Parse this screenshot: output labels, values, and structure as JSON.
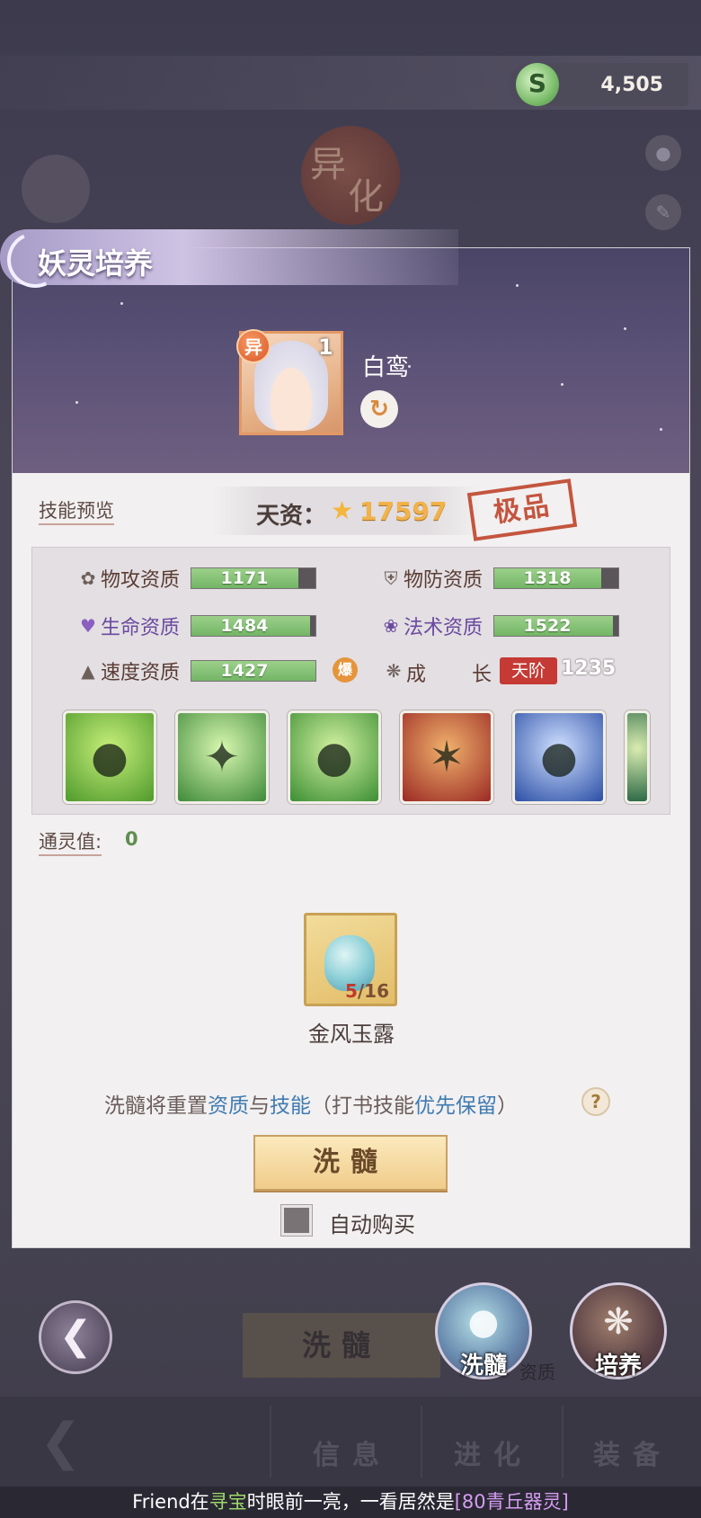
{
  "header": {
    "currency_icon": "jade-coin-icon",
    "currency_value": "4,505"
  },
  "panel": {
    "title": "妖灵培养",
    "pet": {
      "variant_badge": "异",
      "level": "1",
      "name": "白鸾"
    },
    "skill_preview_label": "技能预览",
    "aptitude": {
      "label": "天资：",
      "value": "17597",
      "grade": "极品"
    },
    "stats": [
      {
        "icon": "attack-icon",
        "label": "物攻资质",
        "value": "1171",
        "fill": 0.86
      },
      {
        "icon": "defense-icon",
        "label": "物防资质",
        "value": "1318",
        "fill": 0.86
      },
      {
        "icon": "heart-icon",
        "label": "生命资质",
        "value": "1484",
        "fill": 0.96
      },
      {
        "icon": "magic-icon",
        "label": "法术资质",
        "value": "1522",
        "fill": 0.96
      },
      {
        "icon": "boot-icon",
        "label": "速度资质",
        "value": "1427",
        "fill": 1.0
      }
    ],
    "burst_badge": "爆",
    "growth": {
      "label_a": "成",
      "label_b": "长",
      "tier": "天阶",
      "value": "1235"
    },
    "skills": [
      {
        "name": "skill-cat-rage-icon",
        "colors": [
          "#c7ef7a",
          "#4f9a2c"
        ]
      },
      {
        "name": "skill-wind-slash-icon",
        "colors": [
          "#d8f7b0",
          "#3f8a3a"
        ]
      },
      {
        "name": "skill-cat-orb-icon",
        "colors": [
          "#d2f1a0",
          "#3c8f34"
        ]
      },
      {
        "name": "skill-fire-fang-icon",
        "colors": [
          "#f0b16c",
          "#9b2a24"
        ]
      },
      {
        "name": "skill-shadow-cat-icon",
        "colors": [
          "#cfe0ff",
          "#2c4fa6"
        ]
      },
      {
        "name": "skill-target-icon",
        "colors": [
          "#d9ecb0",
          "#2d6a46"
        ]
      }
    ],
    "spirit": {
      "label": "通灵值:",
      "value": "0"
    },
    "item": {
      "icon": "potion-icon",
      "count_current": "5",
      "count_total": "/16",
      "name": "金风玉露"
    },
    "notice": {
      "part1": "洗髓将重置",
      "hl1": "资质",
      "part2": "与",
      "hl2": "技能",
      "part3": "（打书技能",
      "hl3": "优先保留",
      "part4": "）"
    },
    "wash_button": "洗髓",
    "auto_buy_label": "自动购买",
    "auto_buy_checked": false
  },
  "bottom": {
    "bg_wash_button": "洗髓",
    "bg_aptitude": "资质",
    "fab_wash": "洗髓",
    "fab_train": "培养",
    "tabs": [
      "信息",
      "进化",
      "装备"
    ]
  },
  "ticker": {
    "player": "Friend",
    "t1": "在",
    "place": "寻宝",
    "t2": "时眼前一亮，一看居然是",
    "reward": "[80青丘器灵]"
  }
}
